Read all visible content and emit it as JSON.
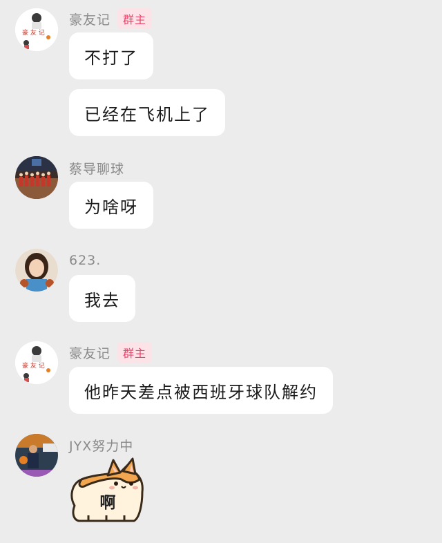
{
  "messages": [
    {
      "sender": "豪友记",
      "badge": "群主",
      "bubbles": [
        "不打了",
        "已经在飞机上了"
      ]
    },
    {
      "sender": "蔡导聊球",
      "bubbles": [
        "为啥呀"
      ]
    },
    {
      "sender": "623.",
      "bubbles": [
        "我去"
      ]
    },
    {
      "sender": "豪友记",
      "badge": "群主",
      "bubbles": [
        "他昨天差点被西班牙球队解约"
      ]
    },
    {
      "sender": "JYX努力中",
      "sticker": {
        "text": "啊",
        "icon": "corgi-sticker-icon"
      }
    }
  ],
  "colors": {
    "background": "#ececec",
    "bubble": "#ffffff",
    "name": "#8a8a8a",
    "badge_bg": "#fbe3e8",
    "badge_text": "#e8456b",
    "corgi_orange": "#f2a650",
    "corgi_cream": "#fff3de"
  }
}
